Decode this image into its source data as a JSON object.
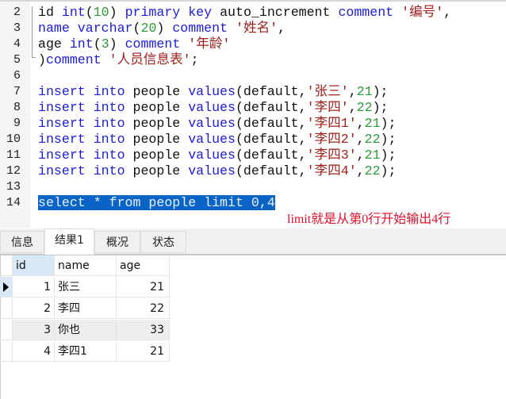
{
  "editor": {
    "lines": [
      {
        "n": "2",
        "tokens": [
          [
            "id ",
            ""
          ],
          [
            "int",
            "kw"
          ],
          [
            "(",
            ""
          ],
          [
            "10",
            "num"
          ],
          [
            ") ",
            ""
          ],
          [
            "primary key",
            "kw"
          ],
          [
            " auto_increment ",
            ""
          ],
          [
            "comment",
            "kw"
          ],
          [
            " ",
            ""
          ],
          [
            "'编号'",
            "str"
          ],
          [
            ",",
            ""
          ]
        ]
      },
      {
        "n": "3",
        "tokens": [
          [
            "name ",
            "kw"
          ],
          [
            "varchar",
            "kw"
          ],
          [
            "(",
            ""
          ],
          [
            "20",
            "num"
          ],
          [
            ") ",
            ""
          ],
          [
            "comment",
            "kw"
          ],
          [
            " ",
            ""
          ],
          [
            "'姓名'",
            "str"
          ],
          [
            ",",
            ""
          ]
        ]
      },
      {
        "n": "4",
        "tokens": [
          [
            "age ",
            ""
          ],
          [
            "int",
            "kw"
          ],
          [
            "(",
            ""
          ],
          [
            "3",
            "num"
          ],
          [
            ") ",
            ""
          ],
          [
            "comment",
            "kw"
          ],
          [
            " ",
            ""
          ],
          [
            "'年龄'",
            "str"
          ]
        ]
      },
      {
        "n": "5",
        "tokens": [
          [
            ")",
            ""
          ],
          [
            "comment",
            "kw"
          ],
          [
            " ",
            ""
          ],
          [
            "'人员信息表'",
            "str"
          ],
          [
            ";",
            ""
          ]
        ]
      },
      {
        "n": "6",
        "tokens": []
      },
      {
        "n": "7",
        "tokens": [
          [
            "insert into",
            "kw"
          ],
          [
            " people ",
            ""
          ],
          [
            "values",
            "kw"
          ],
          [
            "(default,",
            ""
          ],
          [
            "'张三'",
            "str"
          ],
          [
            ",",
            ""
          ],
          [
            "21",
            "num"
          ],
          [
            ");",
            ""
          ]
        ]
      },
      {
        "n": "8",
        "tokens": [
          [
            "insert into",
            "kw"
          ],
          [
            " people ",
            ""
          ],
          [
            "values",
            "kw"
          ],
          [
            "(default,",
            ""
          ],
          [
            "'李四'",
            "str"
          ],
          [
            ",",
            ""
          ],
          [
            "22",
            "num"
          ],
          [
            ");",
            ""
          ]
        ]
      },
      {
        "n": "9",
        "tokens": [
          [
            "insert into",
            "kw"
          ],
          [
            " people ",
            ""
          ],
          [
            "values",
            "kw"
          ],
          [
            "(default,",
            ""
          ],
          [
            "'李四1'",
            "str"
          ],
          [
            ",",
            ""
          ],
          [
            "21",
            "num"
          ],
          [
            ");",
            ""
          ]
        ]
      },
      {
        "n": "10",
        "tokens": [
          [
            "insert into",
            "kw"
          ],
          [
            " people ",
            ""
          ],
          [
            "values",
            "kw"
          ],
          [
            "(default,",
            ""
          ],
          [
            "'李四2'",
            "str"
          ],
          [
            ",",
            ""
          ],
          [
            "22",
            "num"
          ],
          [
            ");",
            ""
          ]
        ]
      },
      {
        "n": "11",
        "tokens": [
          [
            "insert into",
            "kw"
          ],
          [
            " people ",
            ""
          ],
          [
            "values",
            "kw"
          ],
          [
            "(default,",
            ""
          ],
          [
            "'李四3'",
            "str"
          ],
          [
            ",",
            ""
          ],
          [
            "21",
            "num"
          ],
          [
            ");",
            ""
          ]
        ]
      },
      {
        "n": "12",
        "tokens": [
          [
            "insert into",
            "kw"
          ],
          [
            " people ",
            ""
          ],
          [
            "values",
            "kw"
          ],
          [
            "(default,",
            ""
          ],
          [
            "'李四4'",
            "str"
          ],
          [
            ",",
            ""
          ],
          [
            "22",
            "num"
          ],
          [
            ");",
            ""
          ]
        ]
      },
      {
        "n": "13",
        "tokens": []
      },
      {
        "n": "14",
        "tokens": [
          [
            "select * from people limit 0,4",
            "sel"
          ]
        ]
      }
    ],
    "annotation": "limit就是从第0行开始输出4行"
  },
  "tabs": [
    {
      "label": "信息",
      "active": false
    },
    {
      "label": "结果1",
      "active": true
    },
    {
      "label": "概况",
      "active": false
    },
    {
      "label": "状态",
      "active": false
    }
  ],
  "result": {
    "columns": [
      "id",
      "name",
      "age"
    ],
    "rows": [
      [
        "1",
        "张三",
        "21"
      ],
      [
        "2",
        "李四",
        "22"
      ],
      [
        "3",
        "你也",
        "33"
      ],
      [
        "4",
        "李四1",
        "21"
      ]
    ]
  },
  "colors": {
    "keyword": "#1c1cd8",
    "string": "#a0201c",
    "number": "#2f9a3a",
    "selection": "#0a64c8",
    "annotation": "#e0102a"
  }
}
